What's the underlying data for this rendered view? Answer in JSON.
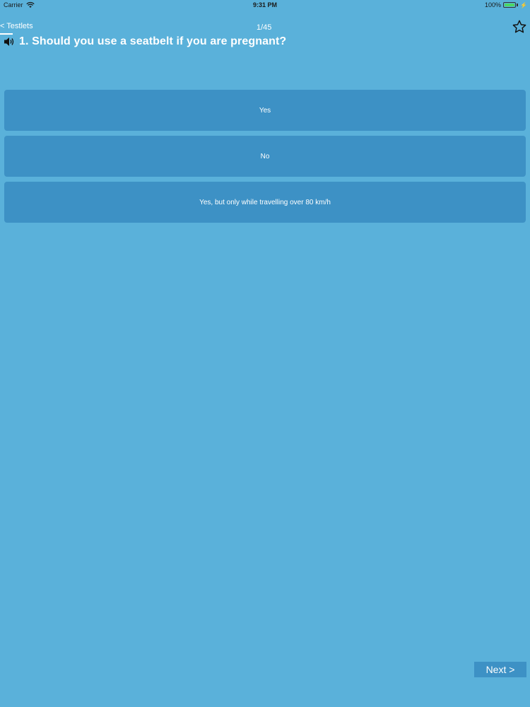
{
  "status_bar": {
    "carrier": "Carrier",
    "time": "9:31 PM",
    "battery": "100%"
  },
  "nav": {
    "back_label": "< Testlets",
    "counter": "1/45",
    "favorite_icon": "star-outline-icon"
  },
  "question": {
    "icon": "speaker-icon",
    "text": "1. Should you use a seatbelt if you are pregnant?"
  },
  "answers": [
    {
      "label": "Yes"
    },
    {
      "label": "No"
    },
    {
      "label": "Yes, but only while travelling over 80 km/h"
    }
  ],
  "footer": {
    "next_label": "Next >"
  },
  "colors": {
    "background": "#5AB1DA",
    "answer_bg": "#3D91C5",
    "text": "#FFFFFF"
  }
}
